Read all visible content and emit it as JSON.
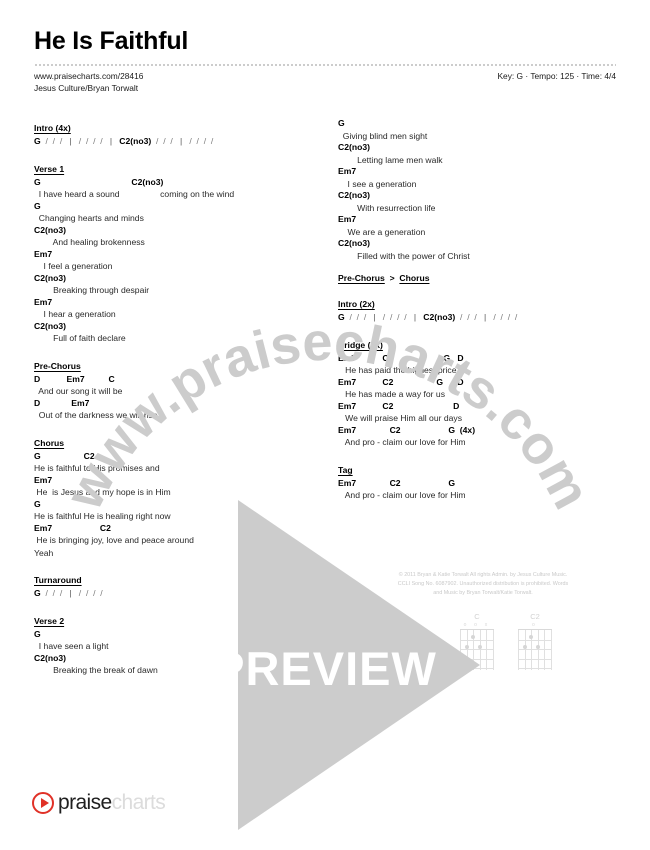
{
  "header": {
    "title": "He Is Faithful",
    "url": "www.praisecharts.com/28416",
    "artist": "Jesus Culture/Bryan Torwalt",
    "meta": "Key: G · Tempo: 125 · Time: 4/4"
  },
  "left_column": [
    {
      "label": "Intro (4x)",
      "lines": [
        {
          "type": "chord",
          "text": "G  /  /  /   |   /  /  /  /   |   C2(no3)  /  /  /   |   /  /  /  /"
        }
      ]
    },
    {
      "label": "Verse 1",
      "lines": [
        {
          "type": "chord",
          "text": "G                                      C2(no3)"
        },
        {
          "type": "lyric",
          "text": "  I have heard a sound                 coming on the wind"
        },
        {
          "type": "chord",
          "text": "G"
        },
        {
          "type": "lyric",
          "text": "  Changing hearts and minds"
        },
        {
          "type": "chord",
          "text": "C2(no3)"
        },
        {
          "type": "lyric",
          "text": "        And healing brokenness"
        },
        {
          "type": "chord",
          "text": "Em7"
        },
        {
          "type": "lyric",
          "text": "    I feel a generation"
        },
        {
          "type": "chord",
          "text": "C2(no3)"
        },
        {
          "type": "lyric",
          "text": "        Breaking through despair"
        },
        {
          "type": "chord",
          "text": "Em7"
        },
        {
          "type": "lyric",
          "text": "    I hear a generation"
        },
        {
          "type": "chord",
          "text": "C2(no3)"
        },
        {
          "type": "lyric",
          "text": "        Full of faith declare"
        }
      ]
    },
    {
      "label": "Pre-Chorus",
      "lines": [
        {
          "type": "chord",
          "text": "D           Em7          C"
        },
        {
          "type": "lyric",
          "text": "  And our song it will be"
        },
        {
          "type": "chord",
          "text": "D             Em7"
        },
        {
          "type": "lyric",
          "text": "  Out of the darkness we will rise"
        }
      ]
    },
    {
      "label": "Chorus",
      "lines": [
        {
          "type": "chord",
          "text": "G                  C2"
        },
        {
          "type": "lyric",
          "text": "He is faithful to His promises and"
        },
        {
          "type": "chord",
          "text": "Em7"
        },
        {
          "type": "lyric",
          "text": " He  is Jesus and my hope is in Him"
        },
        {
          "type": "chord",
          "text": "G"
        },
        {
          "type": "lyric",
          "text": "He is faithful He is healing right now"
        },
        {
          "type": "chord",
          "text": "Em7                    C2"
        },
        {
          "type": "lyric",
          "text": " He is bringing joy, love and peace around"
        },
        {
          "type": "lyric",
          "text": "Yeah"
        }
      ]
    },
    {
      "label": "Turnaround",
      "lines": [
        {
          "type": "chord",
          "text": "G  /  /  /   |   /  /  /  /"
        }
      ]
    },
    {
      "label": "Verse 2",
      "lines": [
        {
          "type": "chord",
          "text": "G"
        },
        {
          "type": "lyric",
          "text": "  I have seen a light"
        },
        {
          "type": "chord",
          "text": "C2(no3)"
        },
        {
          "type": "lyric",
          "text": "        Breaking the break of dawn"
        }
      ]
    }
  ],
  "right_column": [
    {
      "label": "",
      "lines": [
        {
          "type": "chord",
          "text": "G"
        },
        {
          "type": "lyric",
          "text": "  Giving blind men sight"
        },
        {
          "type": "chord",
          "text": "C2(no3)"
        },
        {
          "type": "lyric",
          "text": "        Letting lame men walk"
        },
        {
          "type": "chord",
          "text": "Em7"
        },
        {
          "type": "lyric",
          "text": "    I see a generation"
        },
        {
          "type": "chord",
          "text": "C2(no3)"
        },
        {
          "type": "lyric",
          "text": "        With resurrection life"
        },
        {
          "type": "chord",
          "text": "Em7"
        },
        {
          "type": "lyric",
          "text": "    We are a generation"
        },
        {
          "type": "chord",
          "text": "C2(no3)"
        },
        {
          "type": "lyric",
          "text": "        Filled with the power of Christ"
        }
      ]
    },
    {
      "label": "Pre-Chorus > Chorus",
      "label_parts": [
        "Pre-Chorus",
        ">",
        "Chorus"
      ],
      "lines": []
    },
    {
      "label": "Intro (2x)",
      "lines": [
        {
          "type": "chord",
          "text": "G  /  /  /   |   /  /  /  /   |   C2(no3)  /  /  /   |   /  /  /  /"
        }
      ]
    },
    {
      "label": "Bridge (2x)",
      "lines": [
        {
          "type": "chord",
          "text": "Em7           C2                     G   D"
        },
        {
          "type": "lyric",
          "text": "   He has paid the highest price"
        },
        {
          "type": "chord",
          "text": "Em7           C2                  G      D"
        },
        {
          "type": "lyric",
          "text": "   He has made a way for us"
        },
        {
          "type": "chord",
          "text": "Em7           C2                         D"
        },
        {
          "type": "lyric",
          "text": "   We will praise Him all our days"
        },
        {
          "type": "chord",
          "text": "Em7              C2                    G  (4x)"
        },
        {
          "type": "lyric",
          "text": "   And pro - claim our love for Him"
        }
      ]
    },
    {
      "label": "Tag",
      "lines": [
        {
          "type": "chord",
          "text": "Em7              C2                    G"
        },
        {
          "type": "lyric",
          "text": "   And pro - claim our love for Him"
        }
      ]
    }
  ],
  "copyright": "© 2011 Bryan & Katie Torwalt All rights Admin. by Jesus Culture Music.\nCCLI Song No. 6087902. Unauthorized distribution is prohibited. Words\nand Music by Bryan Torwalt/Katie Torwalt.",
  "chord_diagrams": [
    {
      "name": "C",
      "markers": "o o x"
    },
    {
      "name": "C2",
      "markers": "o"
    }
  ],
  "overlay": {
    "watermark_text": "www.praisecharts.com",
    "preview_text": "PREVIEW",
    "play_icon": "play-triangle-icon"
  },
  "footer": {
    "logo_play_icon": "play-circle-icon",
    "logo_text_strong": "praise",
    "logo_text_dim": "charts"
  },
  "colors": {
    "brand_red": "#e03127",
    "watermark_gray": "#cccccc",
    "text": "#000000"
  }
}
